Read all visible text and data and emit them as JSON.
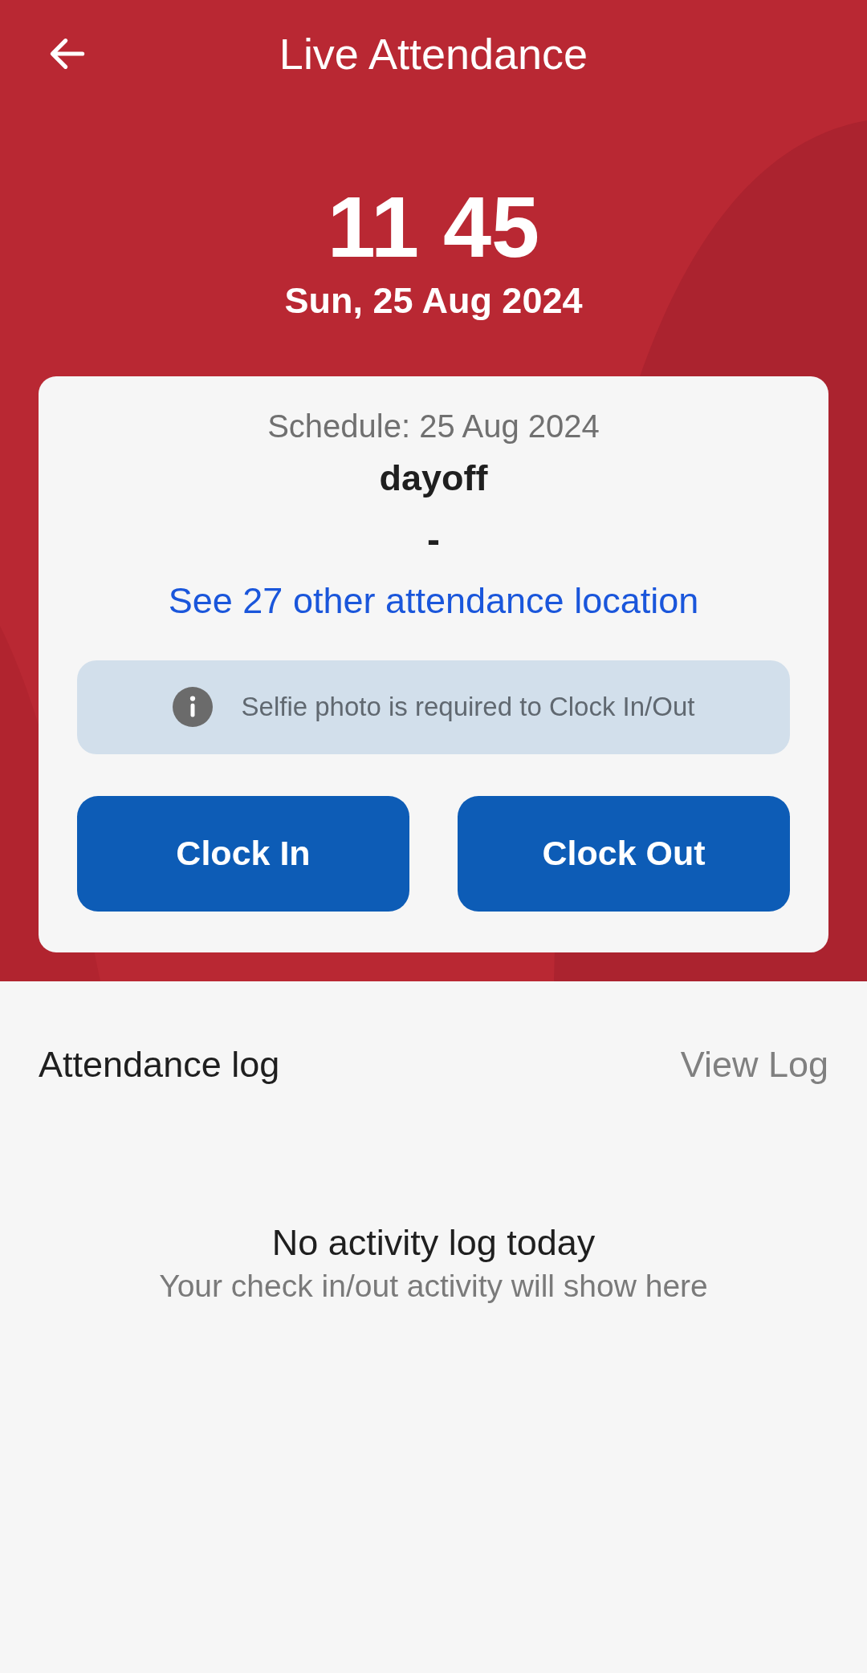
{
  "header": {
    "title": "Live Attendance"
  },
  "clock": {
    "time": "11 45",
    "date": "Sun, 25 Aug 2024"
  },
  "schedule_card": {
    "schedule": "Schedule: 25 Aug 2024",
    "shift": "dayoff",
    "hours": "-",
    "location_link": "See 27 other attendance location",
    "notice": "Selfie photo is required to Clock In/Out",
    "buttons": [
      "Clock In",
      "Clock Out"
    ]
  },
  "attendance_log": {
    "title": "Attendance log",
    "action": "View Log",
    "empty_title": "No activity log today",
    "empty_subtitle": "Your check in/out activity will show here"
  }
}
